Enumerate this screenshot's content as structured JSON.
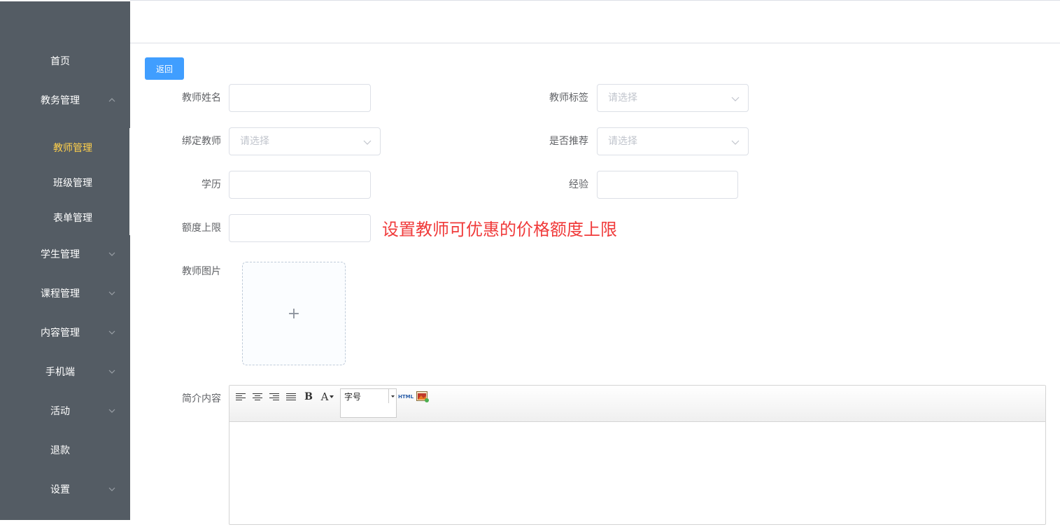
{
  "sidebar": {
    "items": [
      {
        "label": "首页",
        "has_arrow": false
      },
      {
        "label": "教务管理",
        "has_arrow": true,
        "expanded": true
      },
      {
        "label": "学生管理",
        "has_arrow": true
      },
      {
        "label": "课程管理",
        "has_arrow": true
      },
      {
        "label": "内容管理",
        "has_arrow": true
      },
      {
        "label": "手机端",
        "has_arrow": true
      },
      {
        "label": "活动",
        "has_arrow": true
      },
      {
        "label": "退款",
        "has_arrow": false
      },
      {
        "label": "设置",
        "has_arrow": true
      }
    ],
    "subitems": [
      {
        "label": "教师管理",
        "active": true
      },
      {
        "label": "班级管理",
        "active": false
      },
      {
        "label": "表单管理",
        "active": false
      }
    ]
  },
  "actions": {
    "back_label": "返回"
  },
  "form": {
    "teacher_name": {
      "label": "教师姓名",
      "value": ""
    },
    "teacher_tag": {
      "label": "教师标签",
      "placeholder": "请选择"
    },
    "bind_teacher": {
      "label": "绑定教师",
      "placeholder": "请选择"
    },
    "recommend": {
      "label": "是否推荐",
      "placeholder": "请选择"
    },
    "education": {
      "label": "学历",
      "value": ""
    },
    "experience": {
      "label": "经验",
      "value": ""
    },
    "limit": {
      "label": "额度上限",
      "value": ""
    },
    "image": {
      "label": "教师图片",
      "plus": "+"
    },
    "intro": {
      "label": "简介内容"
    }
  },
  "annotation": "设置教师可优惠的价格额度上限",
  "editor": {
    "font_size_label": "字号",
    "html_label": "HTML",
    "bold_label": "B",
    "font_color_label": "A"
  },
  "colors": {
    "sidebar_bg": "#545c64",
    "active_menu": "#ffd04b",
    "primary": "#409eff",
    "annotation": "#f03a3a"
  }
}
